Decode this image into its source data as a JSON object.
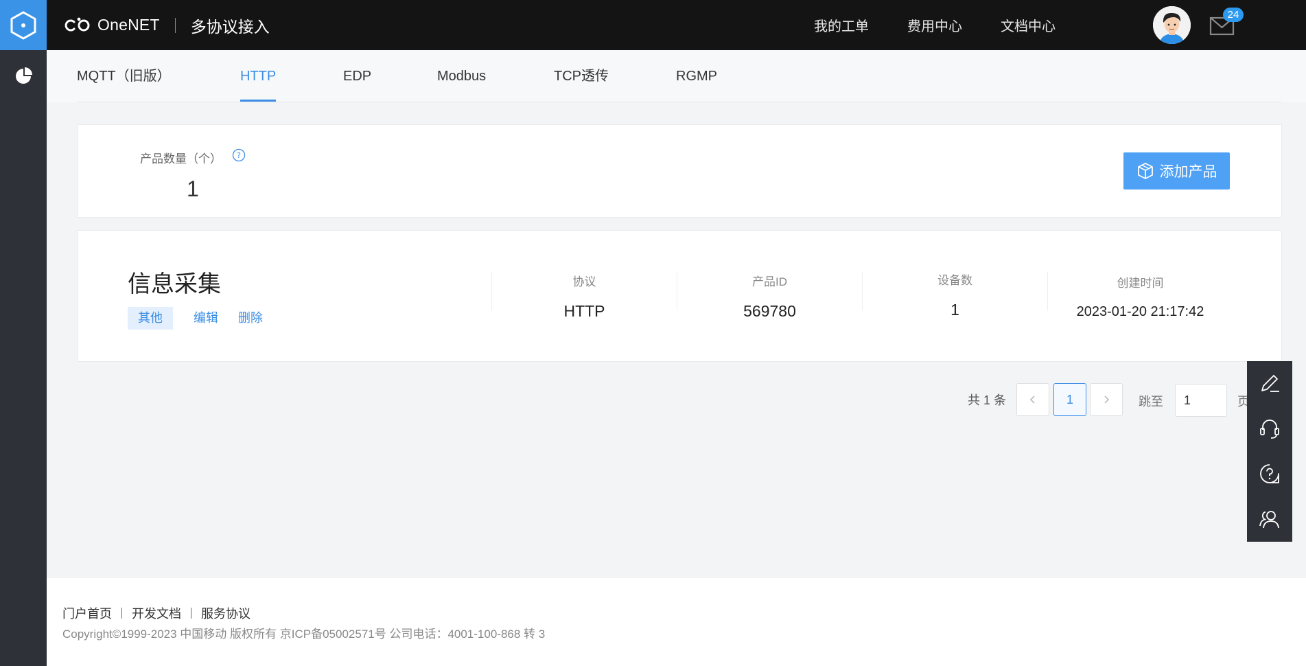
{
  "header": {
    "brand": "OneNET",
    "subtitle": "多协议接入",
    "links": [
      "我的工单",
      "费用中心",
      "文档中心"
    ],
    "mail_badge": "24"
  },
  "tabs": [
    "MQTT（旧版）",
    "HTTP",
    "EDP",
    "Modbus",
    "TCP透传",
    "RGMP"
  ],
  "active_tab": "HTTP",
  "summary": {
    "count_label": "产品数量（个）",
    "count": "1",
    "add_button": "添加产品"
  },
  "product": {
    "name": "信息采集",
    "tag": "其他",
    "edit": "编辑",
    "delete": "删除",
    "columns": [
      {
        "label": "协议",
        "value": "HTTP"
      },
      {
        "label": "产品ID",
        "value": "569780"
      },
      {
        "label": "设备数",
        "value": "1"
      },
      {
        "label": "创建时间",
        "value": "2023-01-20 21:17:42"
      }
    ]
  },
  "pagination": {
    "total": "共 1 条",
    "current_page": "1",
    "jump_label": "跳至",
    "jump_value": "1",
    "page_unit": "页"
  },
  "footer": {
    "links": [
      "门户首页",
      "开发文档",
      "服务协议"
    ],
    "copyright": "Copyright©1999-2023 中国移动 版权所有 京ICP备05002571号 公司电话：4001-100-868 转 3"
  },
  "colors": {
    "accent": "#3b8ee6",
    "topbar": "#141414",
    "sidebar": "#2e3137",
    "button": "#4fa1f5"
  }
}
